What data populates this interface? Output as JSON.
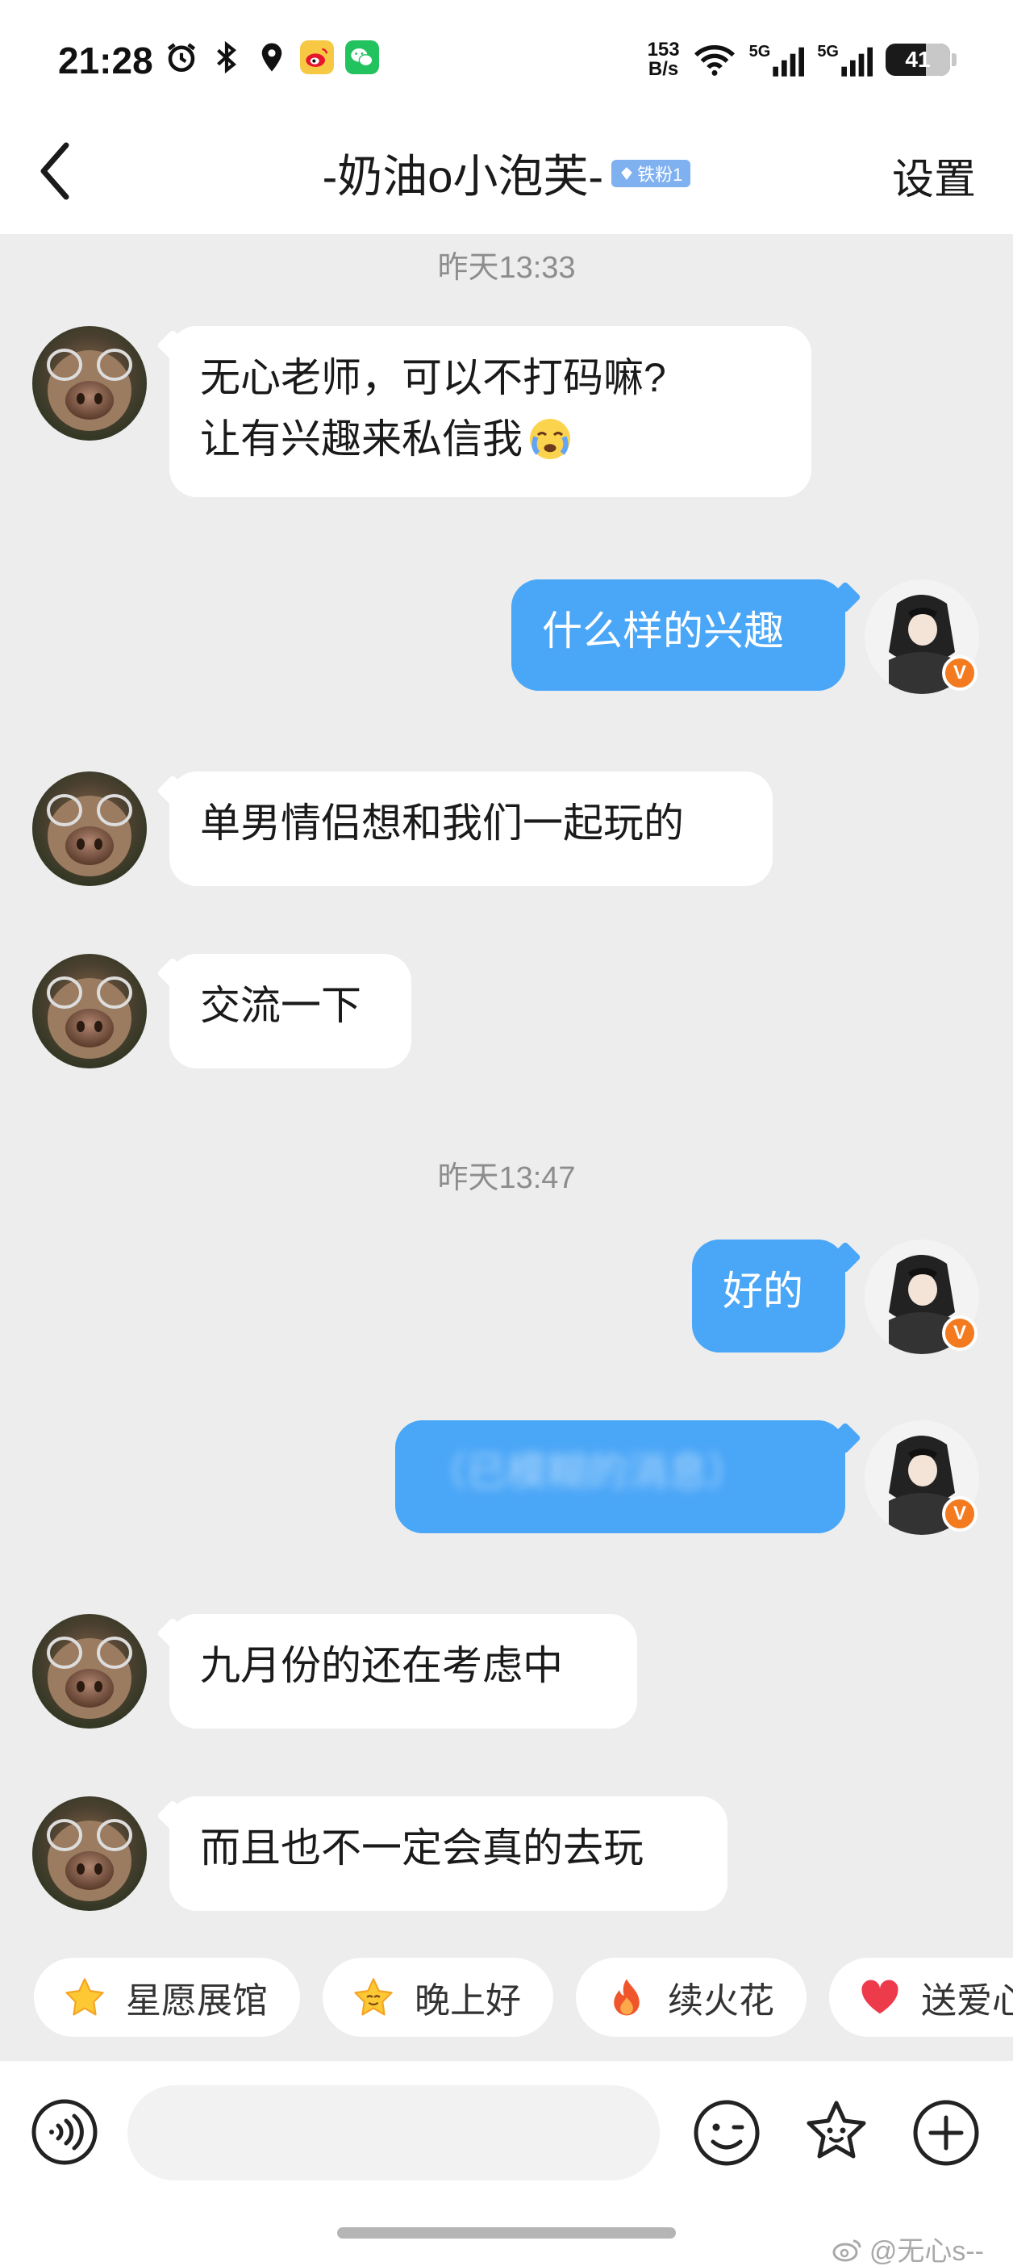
{
  "status_bar": {
    "time": "21:28",
    "net_speed_value": "153",
    "net_speed_unit": "B/s",
    "signal1_label": "5G",
    "signal2_label": "5G",
    "battery": "41",
    "icons": [
      "alarm-icon",
      "bluetooth-icon",
      "location-icon",
      "weibo-app-icon",
      "wechat-app-icon",
      "wifi-icon",
      "signal-icon"
    ]
  },
  "header": {
    "title": "-奶油o小泡芙-",
    "badge": "铁粉1",
    "settings_label": "设置"
  },
  "messages": [
    {
      "type": "timestamp",
      "text": "昨天13:33"
    },
    {
      "type": "in",
      "lines": [
        "无心老师，可以不打码嘛?",
        "让有兴趣来私信我"
      ]
    },
    {
      "type": "out",
      "text": "什么样的兴趣"
    },
    {
      "type": "in",
      "text": "单男情侣想和我们一起玩的"
    },
    {
      "type": "in",
      "text": "交流一下"
    },
    {
      "type": "timestamp",
      "text": "昨天13:47"
    },
    {
      "type": "out",
      "text": "好的"
    },
    {
      "type": "out",
      "text": "（已模糊的消息）",
      "blurred": true
    },
    {
      "type": "in",
      "text": "九月份的还在考虑中"
    },
    {
      "type": "in",
      "text": "而且也不一定会真的去玩"
    }
  ],
  "chips": [
    {
      "label": "星愿展馆",
      "icon": "star-icon"
    },
    {
      "label": "晚上好",
      "icon": "smiling-star-icon"
    },
    {
      "label": "续火花",
      "icon": "fire-icon"
    },
    {
      "label": "送爱心",
      "icon": "heart-icon"
    }
  ],
  "input": {
    "placeholder": ""
  },
  "watermark": "@无心s--",
  "colors": {
    "background": "#ededed",
    "outgoing_bubble": "#4aa6f7",
    "incoming_bubble": "#ffffff",
    "badge": "#7fb0f0",
    "verified": "#f47a1f"
  }
}
